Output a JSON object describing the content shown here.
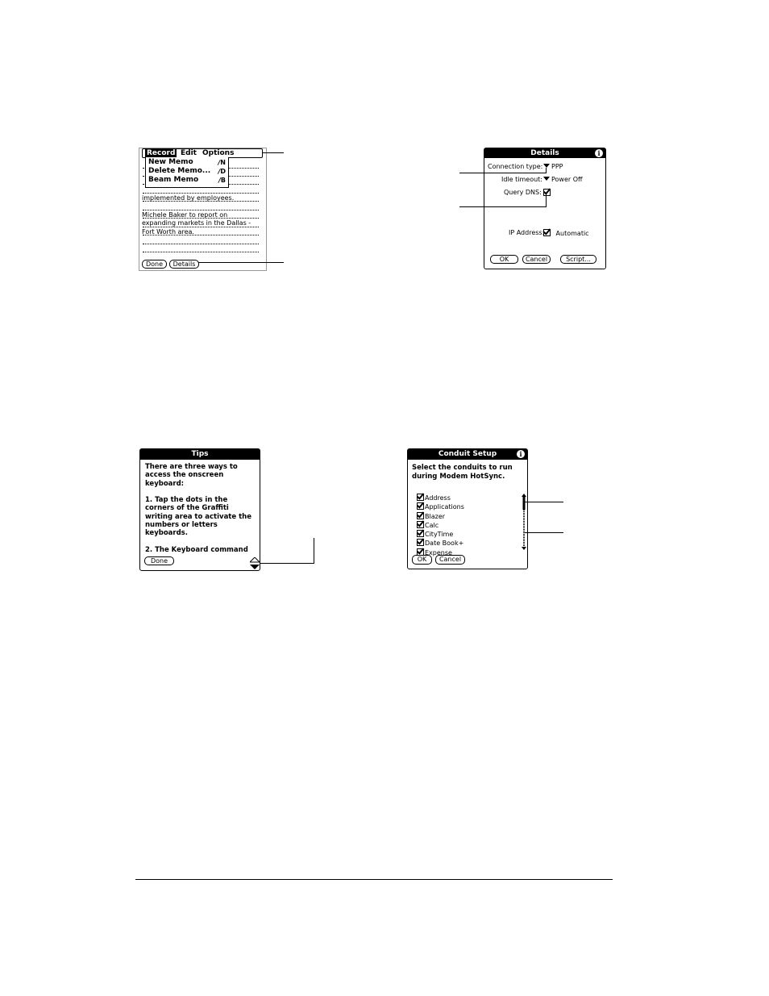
{
  "memo": {
    "menu_items": [
      "Record",
      "Edit",
      "Options"
    ],
    "commands": [
      {
        "label": "New Memo",
        "shortcut": "N"
      },
      {
        "label": "Delete Memo...",
        "shortcut": "D"
      },
      {
        "label": "Beam Memo",
        "shortcut": "B"
      }
    ],
    "text_lines": [
      "implemented by employees.",
      "Michele Baker to report on",
      "expanding markets in the Dallas -",
      "Fort Worth area."
    ],
    "done_label": "Done",
    "details_label": "Details"
  },
  "details": {
    "title": "Details",
    "connection_type_label": "Connection type:",
    "connection_type_value": "PPP",
    "idle_timeout_label": "Idle timeout:",
    "idle_timeout_value": "Power Off",
    "query_dns_label": "Query DNS:",
    "ip_address_label": "IP Address:",
    "ip_address_value": "Automatic",
    "ok_label": "OK",
    "cancel_label": "Cancel",
    "script_label": "Script..."
  },
  "tips": {
    "title": "Tips",
    "lines": [
      "There are three ways to",
      "access the onscreen",
      "keyboard:",
      "",
      "1. Tap the dots in the",
      "corners of the Graffiti",
      "writing area to activate the",
      "numbers or letters",
      "keyboards.",
      "",
      "2. The Keyboard command"
    ],
    "done_label": "Done"
  },
  "conduit": {
    "title": "Conduit Setup",
    "intro_lines": [
      "Select the conduits to run",
      "during Modem HotSync."
    ],
    "items": [
      "Address",
      "Applications",
      "Blazer",
      "Calc",
      "CityTime",
      "Date Book+",
      "Expense"
    ],
    "ok_label": "OK",
    "cancel_label": "Cancel"
  }
}
